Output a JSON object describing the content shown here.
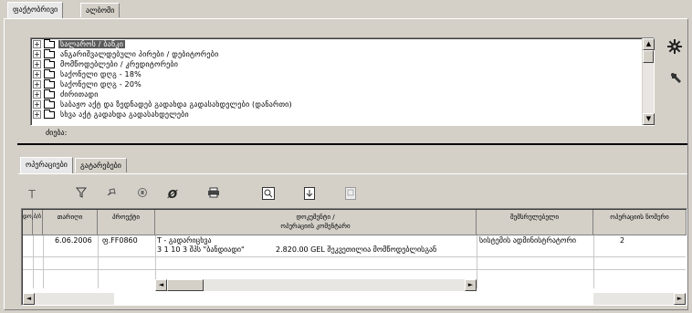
{
  "top_tabs": [
    "ფაქტობრივი",
    "ალბომი"
  ],
  "tree": {
    "items": [
      {
        "label": "სალაროს / ბანკი",
        "selected": true
      },
      {
        "label": "ანგარიშვალდებული პირები / დებიტორები",
        "selected": false
      },
      {
        "label": "მომწოდებლები / კრედიტორები",
        "selected": false
      },
      {
        "label": "საქონელი დღგ - 18%",
        "selected": false
      },
      {
        "label": "საქონელი დღგ - 20%",
        "selected": false
      },
      {
        "label": "ძირითადი",
        "selected": false
      },
      {
        "label": "საბაჟო აქტ და ზედნადებ გადახდა გადასახდელები (დანართი)",
        "selected": false
      },
      {
        "label": "სხვა აქტ გადახდა გადასახდელები",
        "selected": false
      }
    ],
    "search_label": "ძიება:"
  },
  "bottom_tabs": [
    "ოპერაციები",
    "გატარებები"
  ],
  "grid": {
    "headers": {
      "col1": "დოკ",
      "col2": "ბ/ბ",
      "col3": "თარიღი",
      "col4": "პროექტი",
      "col5_line1": "დოკუმენტი /",
      "col5_line2": "ოპერაციის კომენტარი",
      "col6": "შემსრულებელი",
      "col7": "ოპერაციის ნომერი"
    },
    "rows": [
      {
        "date": "6.06.2006",
        "project": "ფ.FF0860",
        "doc_line1": "T - გადარიცხვა",
        "doc_line2_left": "3 1 10 3 შპს \"ბანდიადი\"",
        "doc_line2_right": "2.820.00 GEL შეკვეთილია მომწოდებლისგან",
        "executor": "სისტემის ადმინისტრატორი",
        "op_number": "2"
      }
    ]
  },
  "icons": {
    "side_top": "gear-icon",
    "side_bottom": "tools-icon",
    "toolbar": [
      "text-icon",
      "filter-icon",
      "refresh-icon",
      "stop-icon",
      "delete-icon",
      "print-icon",
      "preview-icon",
      "export-icon",
      "copy-icon"
    ]
  }
}
